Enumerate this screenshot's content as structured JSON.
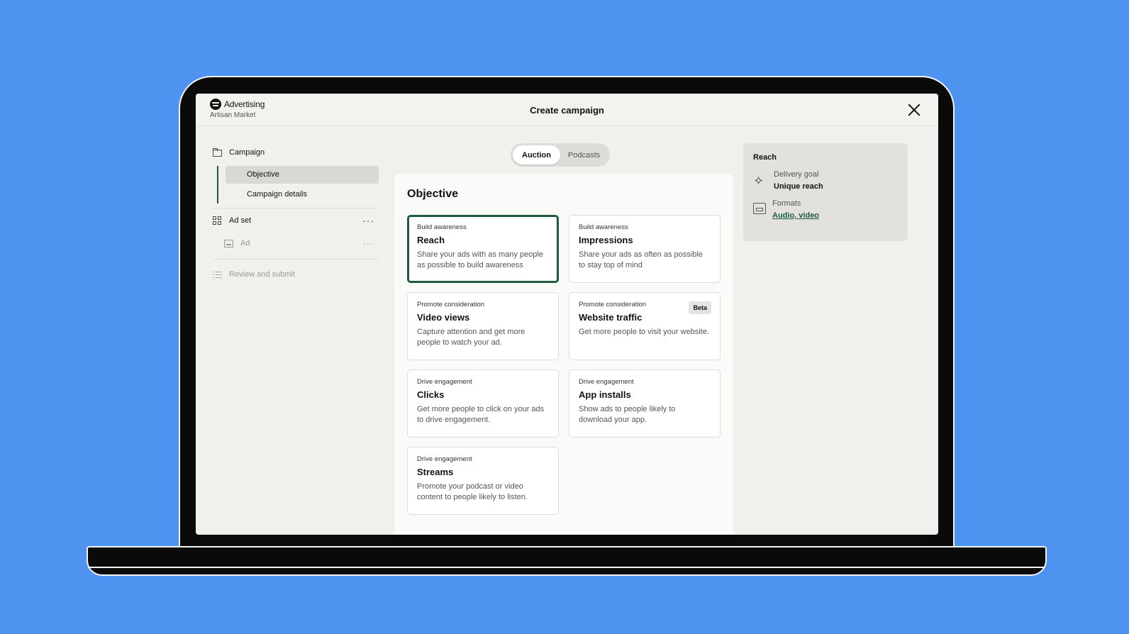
{
  "header": {
    "brand": "Advertising",
    "account": "Artisan Market",
    "title": "Create campaign"
  },
  "nav": {
    "campaign": "Campaign",
    "objective": "Objective",
    "campaign_details": "Campaign details",
    "ad_set": "Ad set",
    "ad": "Ad",
    "review": "Review and submit",
    "more": "···"
  },
  "tabs": {
    "auction": "Auction",
    "podcasts": "Podcasts"
  },
  "main": {
    "title": "Objective",
    "cards": [
      {
        "category": "Build awareness",
        "title": "Reach",
        "desc": "Share your ads with as many people as possible to build awareness"
      },
      {
        "category": "Build awareness",
        "title": "Impressions",
        "desc": "Share your ads as often as possible to stay top of mind"
      },
      {
        "category": "Promote consideration",
        "title": "Video views",
        "desc": "Capture attention and get more people to watch your ad."
      },
      {
        "category": "Promote consideration",
        "title": "Website traffic",
        "desc": "Get more people to visit your website.",
        "badge": "Beta"
      },
      {
        "category": "Drive engagement",
        "title": "Clicks",
        "desc": "Get more people to click on your ads to drive engagement."
      },
      {
        "category": "Drive engagement",
        "title": "App installs",
        "desc": "Show ads to people likely to download your app."
      },
      {
        "category": "Drive engagement",
        "title": "Streams",
        "desc": "Promote your podcast or video content to people likely to listen."
      }
    ]
  },
  "summary": {
    "title": "Reach",
    "goal_label": "Delivery goal",
    "goal_value": "Unique reach",
    "formats_label": "Formats",
    "formats_audio": "Audio",
    "formats_sep": ", ",
    "formats_video": "video"
  },
  "colors": {
    "background": "#4f93f0",
    "accent": "#1d5b3c"
  }
}
